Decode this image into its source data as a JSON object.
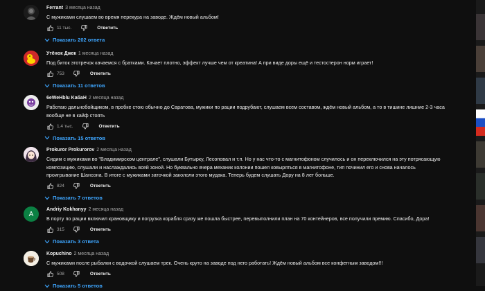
{
  "reply_label": "Ответить",
  "comments": [
    {
      "author": "Ferrant",
      "time": "3 месяца назад",
      "text": "С мужиками слушаем во время перекура на заводе. Ждём новый альбом!",
      "likes": "11 тыс.",
      "replies": "Показать 202 ответа",
      "avatar": "dark-portrait"
    },
    {
      "author": "Утёнок Джек",
      "time": "1 месяца назад",
      "text": "Под биток этотречок качаемся с братками. Качает плотно, эффект лучше чем от креатина! А при виде доры ещё и тестостерон норм играет!",
      "likes": "753",
      "replies": "Показать 11 ответов",
      "avatar": "duck"
    },
    {
      "author": "6eWeHblu KaбaH",
      "time": "2 месяца назад",
      "text": "Работаю дальнобойщиком, в пробке стою обычно до Саратова, мужики по рации подрубают, слушаем всем составом, ждём новый альбом, а то в тишине лишние 2-3 часа вообще не в кайф стоять",
      "likes": "1,4 тыс.",
      "replies": "Показать 15 ответов",
      "avatar": "purple-character"
    },
    {
      "author": "Prokuror Prokurorov",
      "time": "2 месяца назад",
      "text": "Сидим с мужиками во \"Владимирском централе\", слушали Бутырку, Лесоповал и т.п. Но у нас что-то с магнитофоном случилось и он переключился на эту потрясающую композицию, слушали и наслаждались всей зоной. Но буквально вчера механик колонии пошел ковыряться в магнитофоне, тип починил его и снова началось проигрывание Шансона. В итоге с мужиками заточкой закололи этого мудака. Теперь будем слушать Дору на 8 лет больше.",
      "likes": "824",
      "replies": "Показать 7 ответов",
      "avatar": "anime-girl"
    },
    {
      "author": "Andriy Kokhanyy",
      "time": "2 месяца назад",
      "text": "В порту по рации включил крановщику и погрузка корабля сразу же пошла быстрее, перевыполнили план на 70 контейнеров, все получили премию. Спасибо, Дора!",
      "likes": "315",
      "replies": "Показать 3 ответа",
      "avatar": "letter-a",
      "avatar_letter": "A"
    },
    {
      "author": "Kopuchino",
      "time": "2 месяца назад",
      "text": "С мужиками после рыбалки с водочкой слушаем трек. Очень круто на заводе под него работать! Ждём новый альбом все конфетным заводом!!!",
      "likes": "508",
      "replies": "Показать 5 ответов",
      "avatar": "coffee-cup"
    }
  ],
  "colors": {
    "background": "#0f0f0f",
    "text": "#f1f1f1",
    "muted": "#aaaaaa",
    "link": "#3ea6ff",
    "avatar_a": "#0b8043"
  }
}
